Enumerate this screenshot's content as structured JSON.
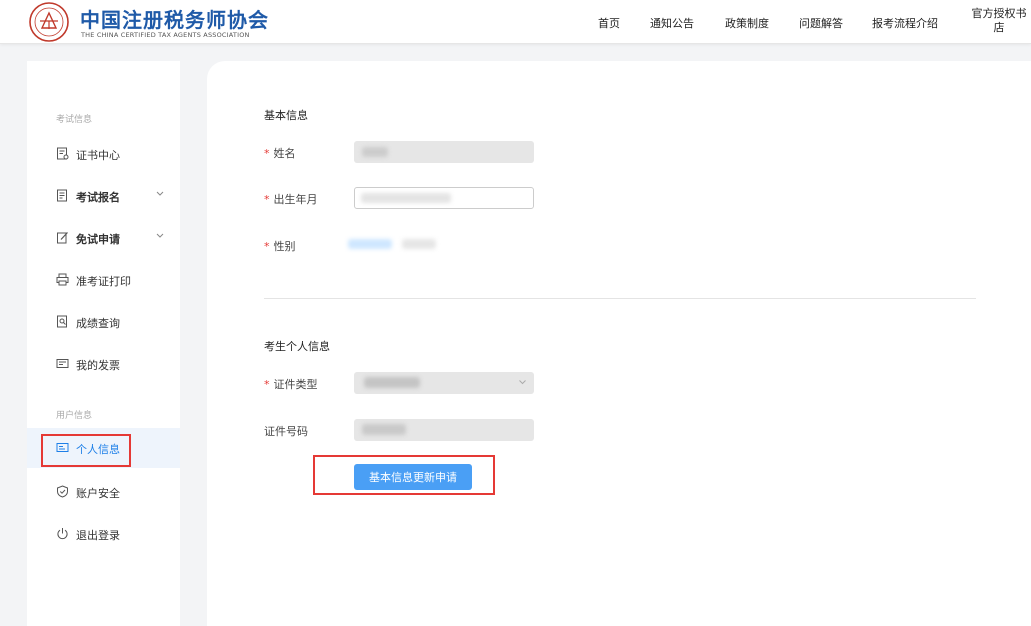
{
  "header": {
    "logo_title": "中国注册税务师协会",
    "logo_subtitle": "THE CHINA CERTIFIED TAX AGENTS ASSOCIATION",
    "nav": [
      "首页",
      "通知公告",
      "政策制度",
      "问题解答",
      "报考流程介绍",
      "官方授权书店"
    ]
  },
  "sidebar": {
    "group1_title": "考试信息",
    "group2_title": "用户信息",
    "items": [
      {
        "label": "证书中心",
        "icon": "certificate-icon"
      },
      {
        "label": "考试报名",
        "icon": "registration-icon",
        "expandable": true
      },
      {
        "label": "免试申请",
        "icon": "exemption-icon",
        "expandable": true
      },
      {
        "label": "准考证打印",
        "icon": "printer-icon"
      },
      {
        "label": "成绩查询",
        "icon": "score-icon"
      },
      {
        "label": "我的发票",
        "icon": "invoice-icon"
      },
      {
        "label": "个人信息",
        "icon": "id-card-icon",
        "active": true
      },
      {
        "label": "账户安全",
        "icon": "shield-icon"
      },
      {
        "label": "退出登录",
        "icon": "power-icon"
      }
    ]
  },
  "form": {
    "basic_title": "基本信息",
    "name_label": "姓名",
    "birth_label": "出生年月",
    "gender_label": "性别",
    "personal_title": "考生个人信息",
    "id_type_label": "证件类型",
    "id_number_label": "证件号码",
    "submit_label": "基本信息更新申请",
    "required_mark": "*"
  },
  "colors": {
    "brand": "#1f5aa8",
    "accent": "#1d7fe8",
    "button": "#4a9ff5",
    "highlight_box": "#e53935"
  }
}
